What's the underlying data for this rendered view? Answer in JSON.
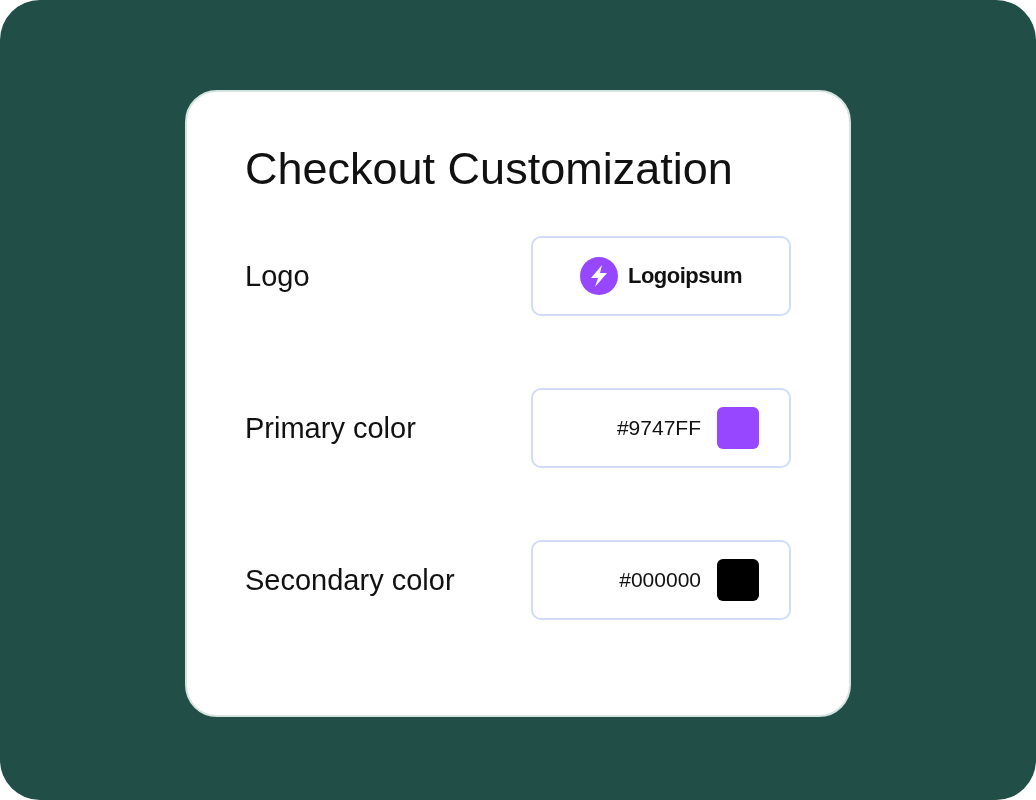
{
  "title": "Checkout Customization",
  "settings": [
    {
      "kind": "logo",
      "label": "Logo",
      "logo_text": "Logoipsum"
    },
    {
      "kind": "color",
      "label": "Primary color",
      "value": "#9747FF",
      "color": "#9747ff"
    },
    {
      "kind": "color",
      "label": "Secondary color",
      "value": "#000000",
      "color": "#000000"
    }
  ]
}
